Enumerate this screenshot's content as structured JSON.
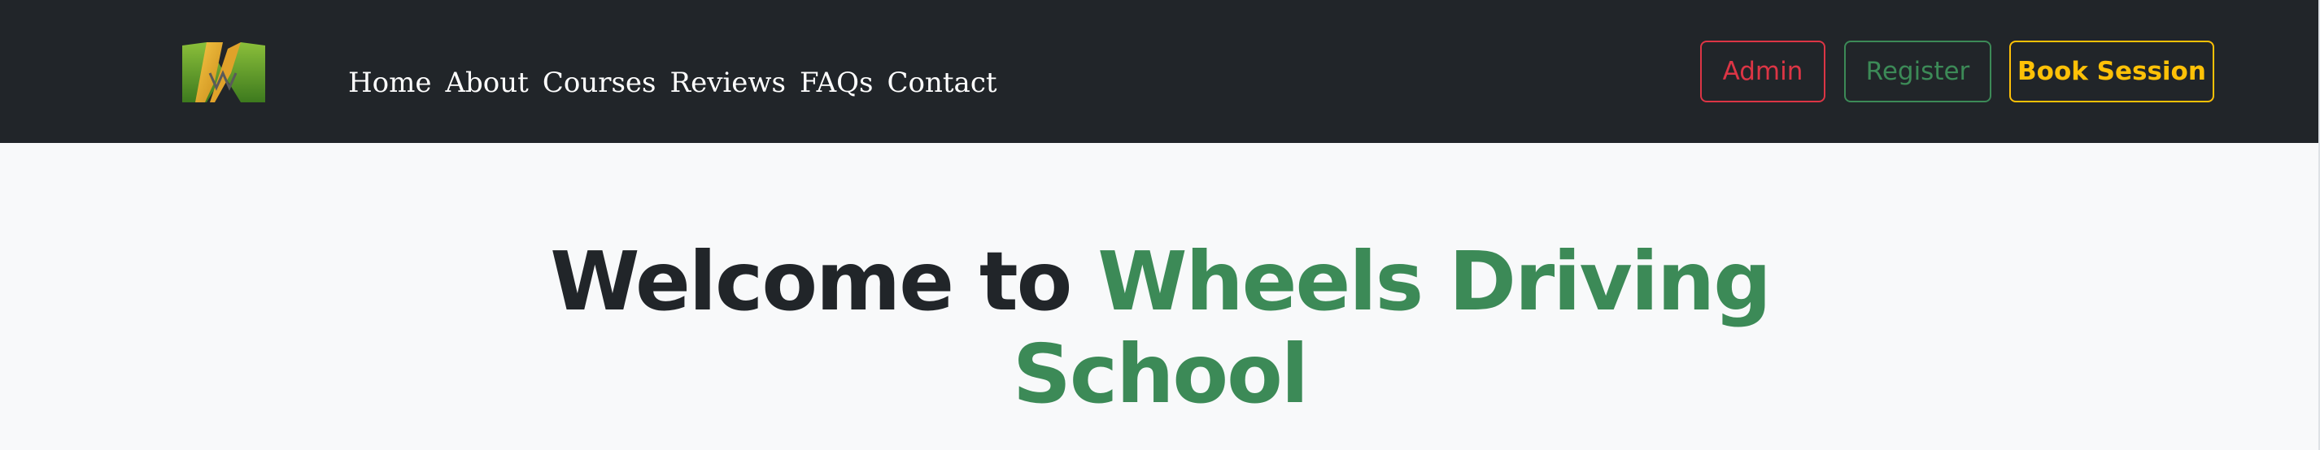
{
  "nav": {
    "links": [
      "Home",
      "About",
      "Courses",
      "Reviews",
      "FAQs",
      "Contact"
    ],
    "logo_icon": "brand-logo-icon"
  },
  "buttons": {
    "admin": "Admin",
    "register": "Register",
    "book": "Book Session"
  },
  "hero": {
    "prefix": "Welcome to",
    "highlight_line1": "Wheels Driving",
    "highlight_line2": "School"
  },
  "colors": {
    "navbar_bg": "#212529",
    "page_bg": "#f8f9fa",
    "danger": "#dc3545",
    "success": "#3c8a57",
    "warning": "#ffc107"
  }
}
